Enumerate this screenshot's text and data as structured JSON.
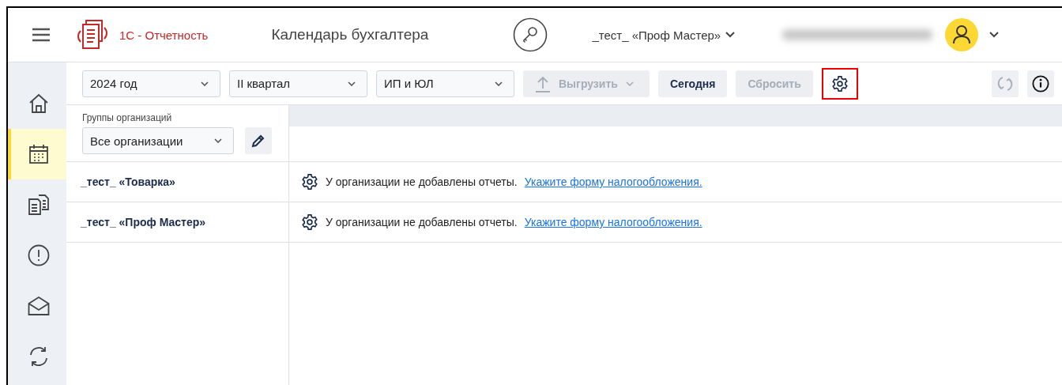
{
  "header": {
    "brand": "1С - Отчетность",
    "title": "Календарь бухгалтера",
    "organization": "_тест_ «Проф Мастер»"
  },
  "sidebar": {
    "items": [
      {
        "kind": "home",
        "selected": false
      },
      {
        "kind": "calendar",
        "selected": true
      },
      {
        "kind": "documents",
        "selected": false
      },
      {
        "kind": "alert",
        "selected": false
      },
      {
        "kind": "mail",
        "selected": false
      },
      {
        "kind": "sync",
        "selected": false
      }
    ]
  },
  "toolbar": {
    "filters": [
      {
        "value": "2024 год"
      },
      {
        "value": "II квартал"
      },
      {
        "value": "ИП и ЮЛ"
      }
    ],
    "export": {
      "label": "Выгрузить",
      "disabled": true
    },
    "buttons": [
      {
        "label": "Сегодня",
        "disabled": false
      },
      {
        "label": "Сбросить",
        "disabled": true
      }
    ],
    "settings": {
      "highlighted": true
    },
    "refresh": {
      "disabled": true
    }
  },
  "groups": {
    "label": "Группы организаций",
    "value": "Все организации"
  },
  "rows": [
    {
      "name": "_тест_ «Товарка»",
      "message": "У организации не добавлены отчеты.",
      "link": "Укажите форму налогообложения."
    },
    {
      "name": "_тест_ «Проф Мастер»",
      "message": "У организации не добавлены отчеты.",
      "link": "Укажите форму налогообложения."
    }
  ]
}
